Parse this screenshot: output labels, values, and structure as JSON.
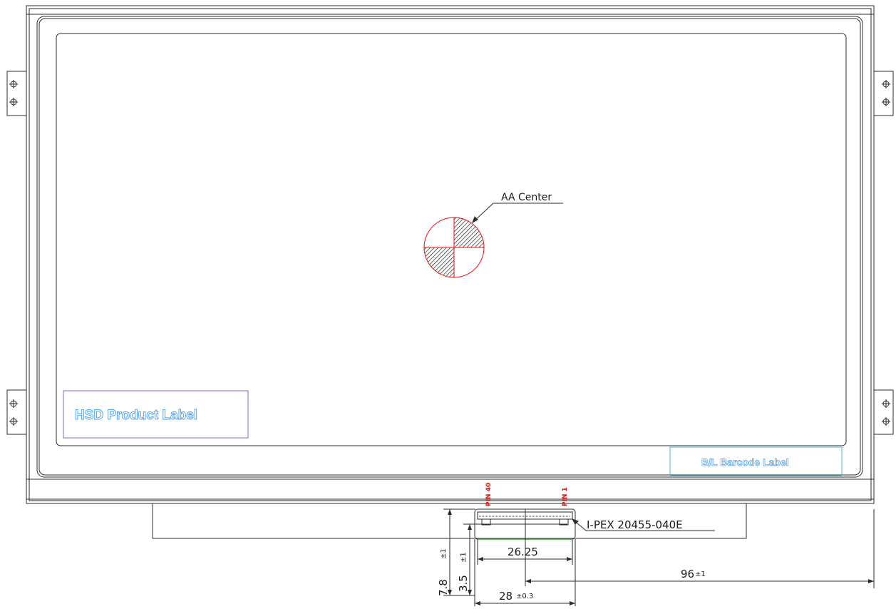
{
  "labels": {
    "aa_center": "AA Center",
    "hsd_product_label": "HSD Product Label",
    "bl_barcode_label": "B/L Barcode Label",
    "connector": "I-PEX 20455-040E",
    "pin40": "PIN 40",
    "pin1": "PIN 1"
  },
  "dimensions": {
    "d_26_25": "26.25",
    "d_28": "28",
    "d_28_tol": "±0.3",
    "d_96": "96",
    "d_96_tol": "±1",
    "d_7_8": "7.8",
    "d_7_8_tol": "±1",
    "d_3_5": "3.5",
    "d_3_5_tol": "±1"
  },
  "colors": {
    "line": "#2b2b2b",
    "frame": "#1a1a1a",
    "label_text": "#3fa0ff",
    "label_box": "#6f6fd8",
    "barcode_box": "#3fbfd8",
    "red": "#e01010",
    "green": "#2fa82f"
  }
}
